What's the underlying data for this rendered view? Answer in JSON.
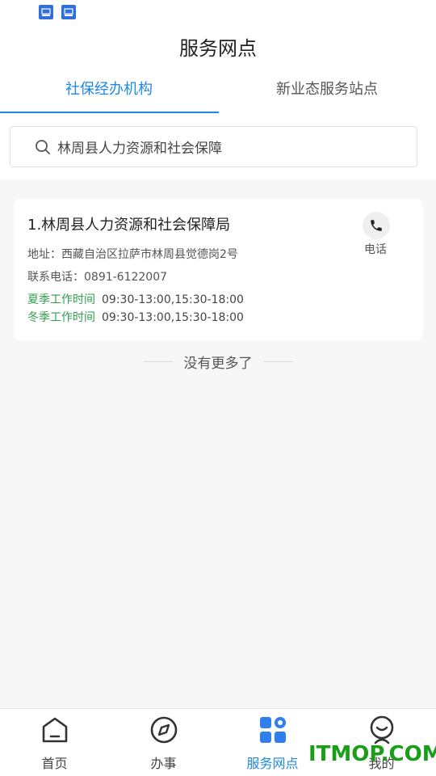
{
  "page": {
    "title": "服务网点",
    "accent_color": "#1e88e5",
    "highlight_color": "#2e9e4a"
  },
  "tabs": [
    {
      "label": "社保经办机构",
      "active": true
    },
    {
      "label": "新业态服务站点",
      "active": false
    }
  ],
  "search": {
    "value": "林周县人力资源和社会保障",
    "icon": "search-icon"
  },
  "results": [
    {
      "title": "1.林周县人力资源和社会保障局",
      "address_label": "地址：",
      "address": "西藏自治区拉萨市林周县觉德岗2号",
      "phone_label": "联系电话：",
      "phone": "0891-6122007",
      "summer_label": "夏季工作时间",
      "summer_hours": "09:30-13:00,15:30-18:00",
      "winter_label": "冬季工作时间",
      "winter_hours": "09:30-13:00,15:30-18:00",
      "call_label": "电话",
      "call_icon": "phone-icon"
    }
  ],
  "list_end": "没有更多了",
  "tabbar": [
    {
      "label": "首页",
      "icon": "home-icon",
      "active": false
    },
    {
      "label": "办事",
      "icon": "compass-icon",
      "active": false
    },
    {
      "label": "服务网点",
      "icon": "grid-icon",
      "active": true
    },
    {
      "label": "我的",
      "icon": "profile-icon",
      "active": false
    }
  ],
  "watermark": "ITMOP.COM"
}
